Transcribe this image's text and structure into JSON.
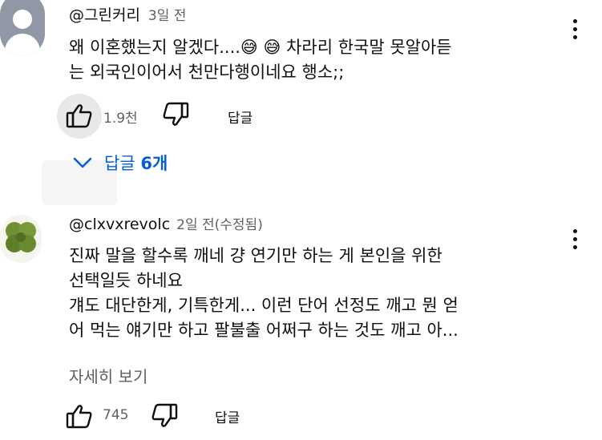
{
  "comments": [
    {
      "author": "@그린커리",
      "time": "3일 전",
      "lines": [
        "왜 이혼했는지 알겠다....😅 😅 차라리 한국말 못알아듣",
        "는 외국인이어서 천만다행이네요 행소;;"
      ],
      "likes": "1.9천",
      "reply_label": "답글",
      "replies_toggle": {
        "label": "답글",
        "count": "6개"
      }
    },
    {
      "author": "@clxvxrevolc",
      "time": "2일 전(수정됨)",
      "lines": [
        "진짜 말을 할수록 깨네 걍 연기만 하는 게 본인을 위한",
        "선택일듯 하네요",
        "걔도 대단한게, 기특한게... 이런 단어 선정도 깨고 뭔 얻",
        "어 먹는 얘기만 하고 팔불출 어쩌구 하는 것도 깨고 아..."
      ],
      "read_more": "자세히 보기",
      "likes": "745",
      "reply_label": "답글"
    }
  ],
  "colors": {
    "link": "#065fd4",
    "secondary_text": "#606060",
    "like_active_bg": "#e8e8e8"
  },
  "icons": [
    "avatar-placeholder-icon",
    "clover-avatar-icon",
    "thumb-up-icon",
    "thumb-down-icon",
    "more-vert-icon",
    "chevron-down-icon"
  ]
}
